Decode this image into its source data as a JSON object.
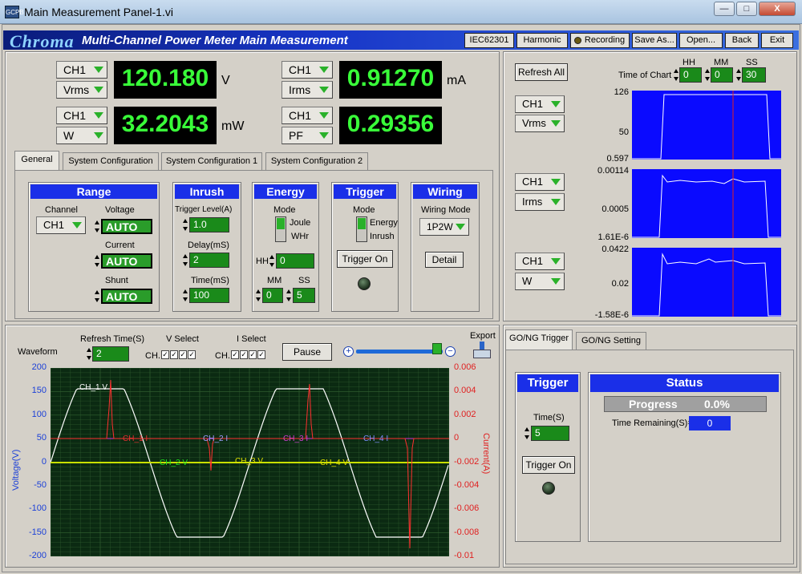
{
  "window": {
    "title": "Main Measurement Panel-1.vi",
    "app_icon": "GCPB",
    "minimize": "—",
    "maximize": "□",
    "close": "X"
  },
  "header": {
    "logo": "Chroma",
    "title": "Multi-Channel Power Meter Main Measurement",
    "buttons": [
      "IEC62301",
      "Harmonic",
      "Recording",
      "Save As...",
      "Open...",
      "Back",
      "Exit"
    ]
  },
  "measurements": [
    {
      "channel": "CH1",
      "param": "Vrms",
      "value": "120.180",
      "unit": "V"
    },
    {
      "channel": "CH1",
      "param": "Irms",
      "value": "0.91270",
      "unit": "mA"
    },
    {
      "channel": "CH1",
      "param": "W",
      "value": "32.2043",
      "unit": "mW"
    },
    {
      "channel": "CH1",
      "param": "PF",
      "value": "0.29356",
      "unit": ""
    }
  ],
  "tabs": [
    "General",
    "System Configuration",
    "System Configuration 1",
    "System Configuration 2"
  ],
  "range": {
    "title": "Range",
    "channel_label": "Channel",
    "channel": "CH1",
    "voltage_label": "Voltage",
    "voltage": "AUTO",
    "current_label": "Current",
    "current": "AUTO",
    "shunt_label": "Shunt",
    "shunt": "AUTO"
  },
  "inrush": {
    "title": "Inrush",
    "trigger_label": "Trigger Level(A)",
    "trigger": "1.0",
    "delay_label": "Delay(mS)",
    "delay": "2",
    "time_label": "Time(mS)",
    "time": "100"
  },
  "energy": {
    "title": "Energy",
    "mode_label": "Mode",
    "opt1": "Joule",
    "opt2": "WHr",
    "hh_label": "HH",
    "hh": "0",
    "mm_label": "MM",
    "mm": "0",
    "ss_label": "SS",
    "ss": "5"
  },
  "trigger": {
    "title": "Trigger",
    "mode_label": "Mode",
    "opt1": "Energy",
    "opt2": "Inrush",
    "button": "Trigger On"
  },
  "wiring": {
    "title": "Wiring",
    "mode_label": "Wiring Mode",
    "mode": "1P2W",
    "detail": "Detail"
  },
  "charts_panel": {
    "refresh_all": "Refresh All",
    "time_label": "Time of Chart",
    "hh_label": "HH",
    "mm_label": "MM",
    "ss_label": "SS",
    "hh": "0",
    "mm": "0",
    "ss": "30",
    "charts": [
      {
        "channel": "CH1",
        "param": "Vrms",
        "ticks": [
          "126",
          "50",
          "0.597"
        ]
      },
      {
        "channel": "CH1",
        "param": "Irms",
        "ticks": [
          "0.00114",
          "0.0005",
          "1.61E-6"
        ]
      },
      {
        "channel": "CH1",
        "param": "W",
        "ticks": [
          "0.0422",
          "0.02",
          "-1.58E-6"
        ]
      }
    ]
  },
  "waveform": {
    "label": "Waveform",
    "refresh_label": "Refresh Time(S)",
    "refresh": "2",
    "v_select_label": "V Select",
    "i_select_label": "I Select",
    "ch_label": "CH.",
    "check": "✓",
    "pause": "Pause",
    "export_label": "Export",
    "export_icon": "export-icon",
    "y_left_label": "Voltage(V)",
    "y_right_label": "Current(A)",
    "y_left_ticks": [
      "200",
      "150",
      "100",
      "50",
      "0",
      "-50",
      "-100",
      "-150",
      "-200"
    ],
    "y_right_ticks": [
      "0.006",
      "0.004",
      "0.002",
      "0",
      "-0.002",
      "-0.004",
      "-0.006",
      "-0.008",
      "-0.01"
    ],
    "series_labels": [
      "CH_1 V",
      "CH_1 I",
      "CH_2 I",
      "CH_3 I",
      "CH_4 I",
      "CH_2 V",
      "CH_3 V",
      "CH_4 V"
    ]
  },
  "gong": {
    "tabs": [
      "GO/NG Trigger",
      "GO/NG Setting"
    ],
    "trigger_title": "Trigger",
    "time_label": "Time(S)",
    "time": "5",
    "trigger_button": "Trigger On",
    "status_title": "Status",
    "progress_label": "Progress",
    "progress": "0.0%",
    "progress_value": 0.0,
    "remaining_label": "Time Remaining(S)=",
    "remaining": "0"
  },
  "colors": {
    "display_bg": "#000000",
    "display_fg": "#39ff39",
    "header_blue": "#1a2fe8",
    "chart_blue": "#0a0aff",
    "waveform_bg": "#0b2a12"
  }
}
